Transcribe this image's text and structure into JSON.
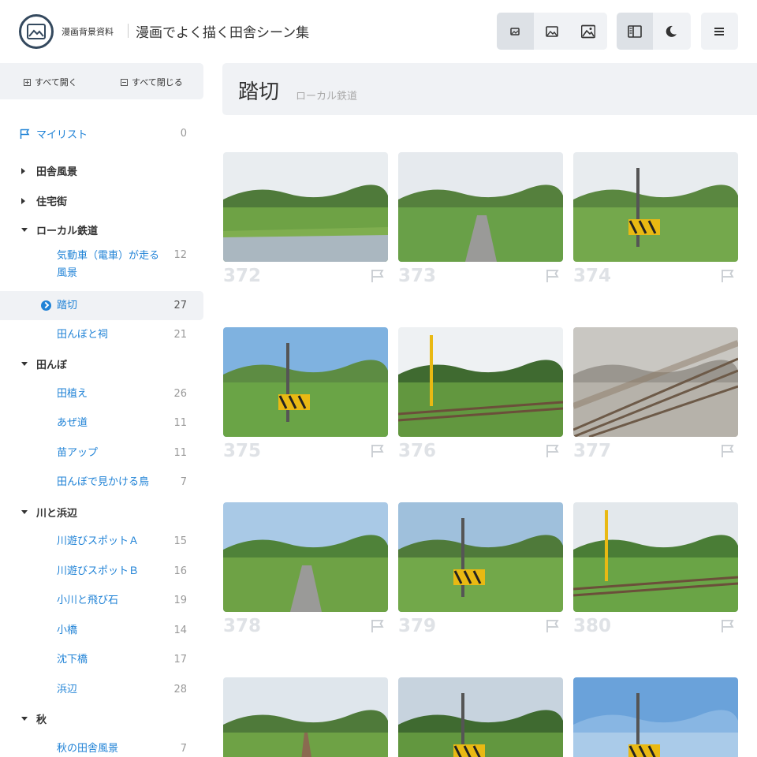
{
  "header": {
    "site_name": "漫画背景資料",
    "page_heading": "漫画でよく描く田舎シーン集"
  },
  "sidebar": {
    "expand_all": "すべて開く",
    "collapse_all": "すべて閉じる",
    "mylist": {
      "label": "マイリスト",
      "count": "0"
    },
    "cat_inaka": "田舎風景",
    "cat_jutaku": "住宅街",
    "cat_local": "ローカル鉄道",
    "sub_kidosha": "気動車（電車）が走る風景",
    "sub_kidosha_count": "12",
    "sub_fumikiri": "踏切",
    "sub_fumikiri_count": "27",
    "sub_hokora": "田んぼと祠",
    "sub_hokora_count": "21",
    "cat_tanbo": "田んぼ",
    "sub_taue": "田植え",
    "sub_taue_count": "26",
    "sub_azemichi": "あぜ道",
    "sub_azemichi_count": "11",
    "sub_nae": "苗アップ",
    "sub_nae_count": "11",
    "sub_tori": "田んぼで見かける鳥",
    "sub_tori_count": "7",
    "cat_kawa": "川と浜辺",
    "sub_kawaA": "川遊びスポットＡ",
    "sub_kawaA_count": "15",
    "sub_kawaB": "川遊びスポットＢ",
    "sub_kawaB_count": "16",
    "sub_ogawa": "小川と飛び石",
    "sub_ogawa_count": "19",
    "sub_kobashi": "小橋",
    "sub_kobashi_count": "14",
    "sub_chinka": "沈下橋",
    "sub_chinka_count": "17",
    "sub_hamabe": "浜辺",
    "sub_hamabe_count": "28",
    "cat_aki": "秋",
    "sub_akifukei": "秋の田舎風景",
    "sub_akifukei_count": "7"
  },
  "main": {
    "title": "踏切",
    "subtitle": "ローカル鉄道",
    "cards": [
      "372",
      "373",
      "374",
      "375",
      "376",
      "377",
      "378",
      "379",
      "380"
    ]
  },
  "colors": {
    "accent": "#1f82d6",
    "panel": "#f0f2f5",
    "number": "#dfe2e6"
  }
}
